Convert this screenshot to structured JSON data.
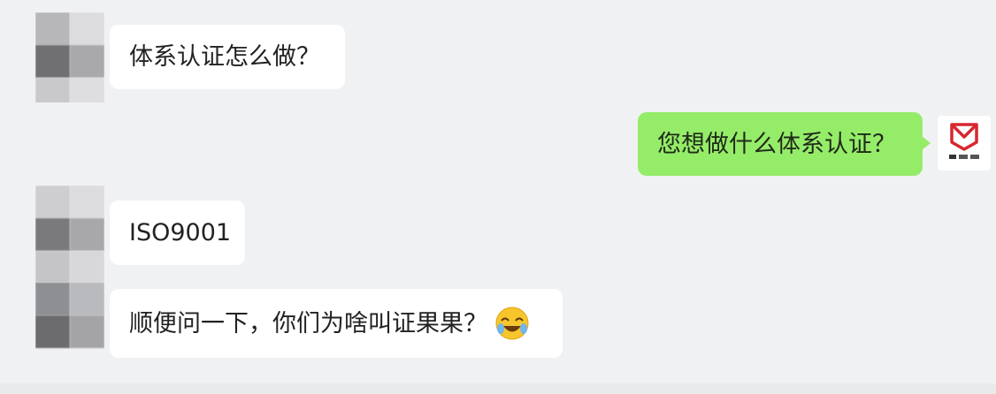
{
  "messages": [
    {
      "from": "contact",
      "text": "体系认证怎么做？"
    },
    {
      "from": "me",
      "text": "您想做什么体系认证？"
    },
    {
      "from": "contact",
      "text": "ISO9001"
    },
    {
      "from": "contact",
      "text": "顺便问一下，你们为啥叫证果果？",
      "emoji": "laughing-tears-emoji"
    }
  ],
  "colors": {
    "background": "#f0f1f3",
    "incoming_bubble": "#ffffff",
    "outgoing_bubble": "#95ec69",
    "logo_red": "#d8262f"
  },
  "icons": {
    "contact_avatar": "pixelated-avatar",
    "my_avatar": "red-logo-avatar",
    "emoji": "laughing-tears-emoji"
  }
}
